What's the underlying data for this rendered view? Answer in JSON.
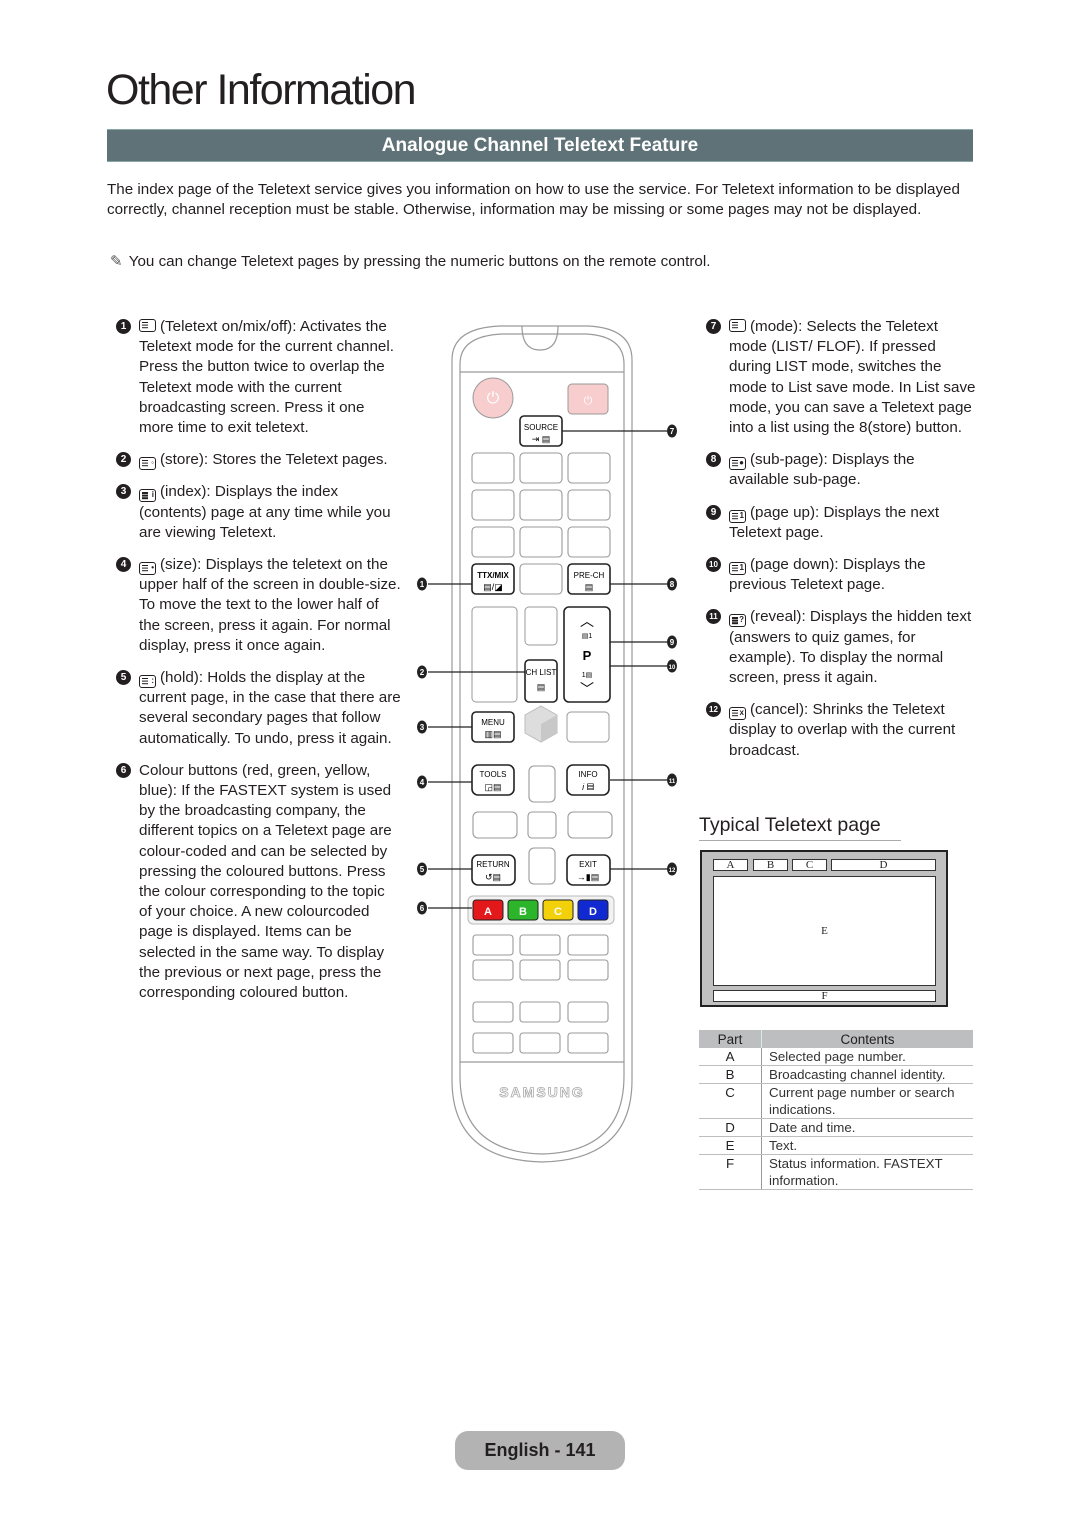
{
  "page": {
    "title": "Other Information",
    "section_heading": "Analogue Channel Teletext Feature",
    "intro": "The index page of the Teletext service gives you information on how to use the service. For Teletext information to be displayed correctly, channel reception must be stable. Otherwise, information may be missing or some pages may not be displayed.",
    "note_icon": "pencil-note-icon",
    "note": "You can change Teletext pages by pressing the numeric buttons on the remote control."
  },
  "left_items": [
    {
      "num": "1",
      "icon": "teletext-on-mix-off-icon",
      "text": "(Teletext on/mix/off): Activates the Teletext mode for the current channel. Press the button twice to overlap the Teletext mode with the current broadcasting screen. Press it one more time to exit teletext."
    },
    {
      "num": "2",
      "icon": "store-icon",
      "text": "(store): Stores the Teletext pages."
    },
    {
      "num": "3",
      "icon": "index-icon",
      "text": "(index): Displays the index (contents) page at any time while you are viewing Teletext."
    },
    {
      "num": "4",
      "icon": "size-icon",
      "text": "(size): Displays the teletext on the upper half of the screen in double-size. To move the text to the lower half of the screen, press it again. For normal display, press it once again."
    },
    {
      "num": "5",
      "icon": "hold-icon",
      "text": "(hold): Holds the display at the current page, in the case that there are several secondary pages that follow automatically. To undo, press it again."
    },
    {
      "num": "6",
      "icon": "",
      "text": "Colour buttons (red, green, yellow, blue): If the FASTEXT system is used by the broadcasting company, the different topics on a Teletext page are colour-coded and can be selected by pressing the coloured buttons. Press the colour corresponding to the topic of your choice. A new colourcoded page is displayed. Items can be selected in the same way. To display the previous or next page, press the corresponding coloured button."
    }
  ],
  "right_items": [
    {
      "num": "7",
      "icon": "mode-icon",
      "text": "(mode): Selects the Teletext mode (LIST/ FLOF). If pressed during LIST mode, switches the mode to List save mode. In List save mode, you can save a Teletext page into a list using the 8(store) button."
    },
    {
      "num": "8",
      "icon": "sub-page-icon",
      "text": "(sub-page): Displays the available sub-page."
    },
    {
      "num": "9",
      "icon": "page-up-icon",
      "text": "(page up): Displays the next Teletext page."
    },
    {
      "num": "10",
      "icon": "page-down-icon",
      "text": "(page down): Displays the previous Teletext page."
    },
    {
      "num": "11",
      "icon": "reveal-icon",
      "text": "(reveal): Displays the hidden text (answers to quiz games, for example). To display the normal screen, press it again."
    },
    {
      "num": "12",
      "icon": "cancel-icon",
      "text": "(cancel): Shrinks the Teletext display to overlap with the current broadcast."
    }
  ],
  "remote": {
    "source": "SOURCE",
    "ttx_mix": "TTX/MIX",
    "pre_ch": "PRE-CH",
    "ch_list": "CH LIST",
    "p": "P",
    "menu": "MENU",
    "tools": "TOOLS",
    "info": "INFO",
    "return": "RETURN",
    "exit": "EXIT",
    "brand": "SAMSUNG",
    "color_buttons": [
      {
        "label": "A",
        "color": "#e3181b"
      },
      {
        "label": "B",
        "color": "#2cb52b"
      },
      {
        "label": "C",
        "color": "#f2d10a"
      },
      {
        "label": "D",
        "color": "#1029d1"
      }
    ],
    "power_color": "#f7cdcd",
    "callouts": [
      "1",
      "2",
      "3",
      "4",
      "5",
      "6",
      "7",
      "8",
      "9",
      "10",
      "11",
      "12"
    ]
  },
  "typical": {
    "title": "Typical Teletext page",
    "cells": {
      "A": "A",
      "B": "B",
      "C": "C",
      "D": "D",
      "E": "E",
      "F": "F"
    }
  },
  "parts_table": {
    "headers": [
      "Part",
      "Contents"
    ],
    "rows": [
      {
        "part": "A",
        "contents": "Selected page number."
      },
      {
        "part": "B",
        "contents": "Broadcasting channel identity."
      },
      {
        "part": "C",
        "contents": "Current page number or search indications."
      },
      {
        "part": "D",
        "contents": "Date and time."
      },
      {
        "part": "E",
        "contents": "Text."
      },
      {
        "part": "F",
        "contents": "Status information. FASTEXT information."
      }
    ]
  },
  "footer": {
    "page_label": "English - 141"
  }
}
